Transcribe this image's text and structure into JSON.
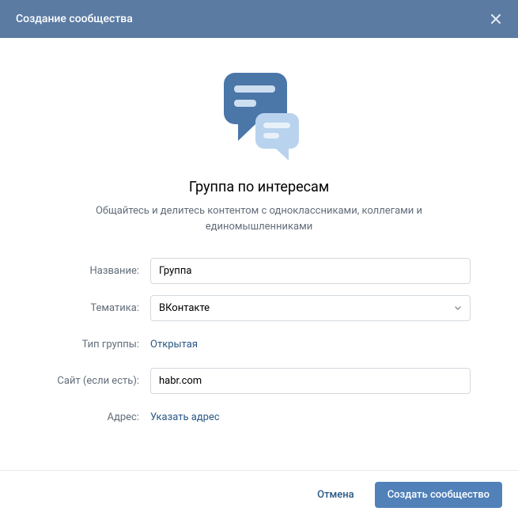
{
  "header": {
    "title": "Создание сообщества"
  },
  "hero": {
    "title": "Группа по интересам",
    "subtitle": "Общайтесь и делитесь контентом с одноклассниками, коллегами и единомышленниками"
  },
  "form": {
    "name_label": "Название:",
    "name_value": "Группа",
    "topic_label": "Тематика:",
    "topic_value": "ВКонтакте",
    "group_type_label": "Тип группы:",
    "group_type_value": "Открытая",
    "website_label": "Сайт (если есть):",
    "website_value": "habr.com",
    "address_label": "Адрес:",
    "address_value": "Указать адрес"
  },
  "footer": {
    "cancel_label": "Отмена",
    "submit_label": "Создать сообщество"
  }
}
